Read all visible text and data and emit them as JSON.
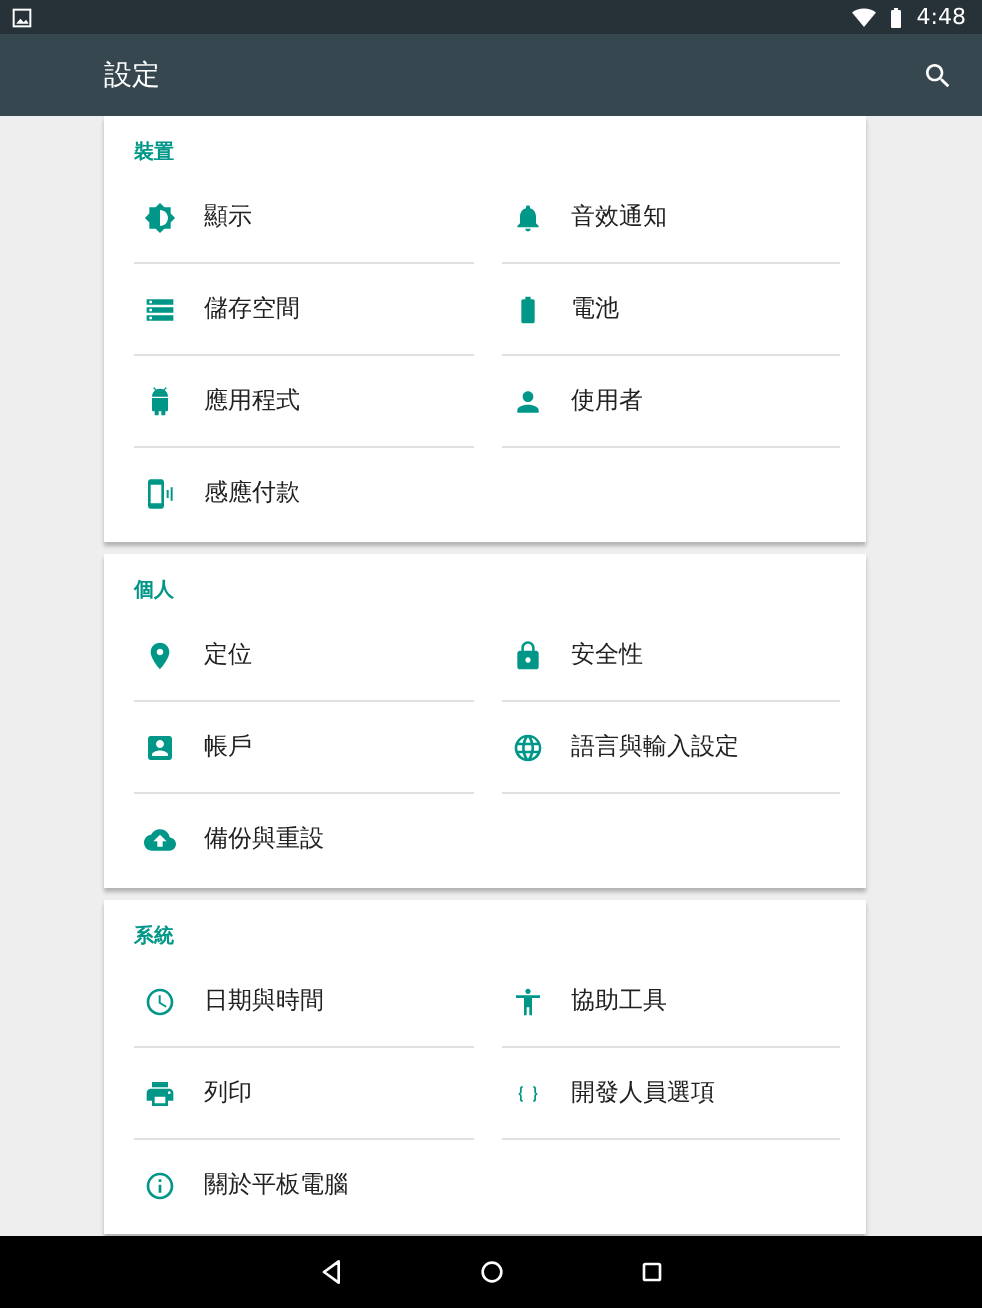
{
  "status_bar": {
    "time": "4:48"
  },
  "toolbar": {
    "title": "設定"
  },
  "sections": [
    {
      "title": "裝置",
      "items": [
        {
          "label": "顯示"
        },
        {
          "label": "音效通知"
        },
        {
          "label": "儲存空間"
        },
        {
          "label": "電池"
        },
        {
          "label": "應用程式"
        },
        {
          "label": "使用者"
        },
        {
          "label": "感應付款"
        }
      ]
    },
    {
      "title": "個人",
      "items": [
        {
          "label": "定位"
        },
        {
          "label": "安全性"
        },
        {
          "label": "帳戶"
        },
        {
          "label": "語言與輸入設定"
        },
        {
          "label": "備份與重設"
        }
      ]
    },
    {
      "title": "系統",
      "items": [
        {
          "label": "日期與時間"
        },
        {
          "label": "協助工具"
        },
        {
          "label": "列印"
        },
        {
          "label": "開發人員選項"
        },
        {
          "label": "關於平板電腦"
        }
      ]
    }
  ]
}
